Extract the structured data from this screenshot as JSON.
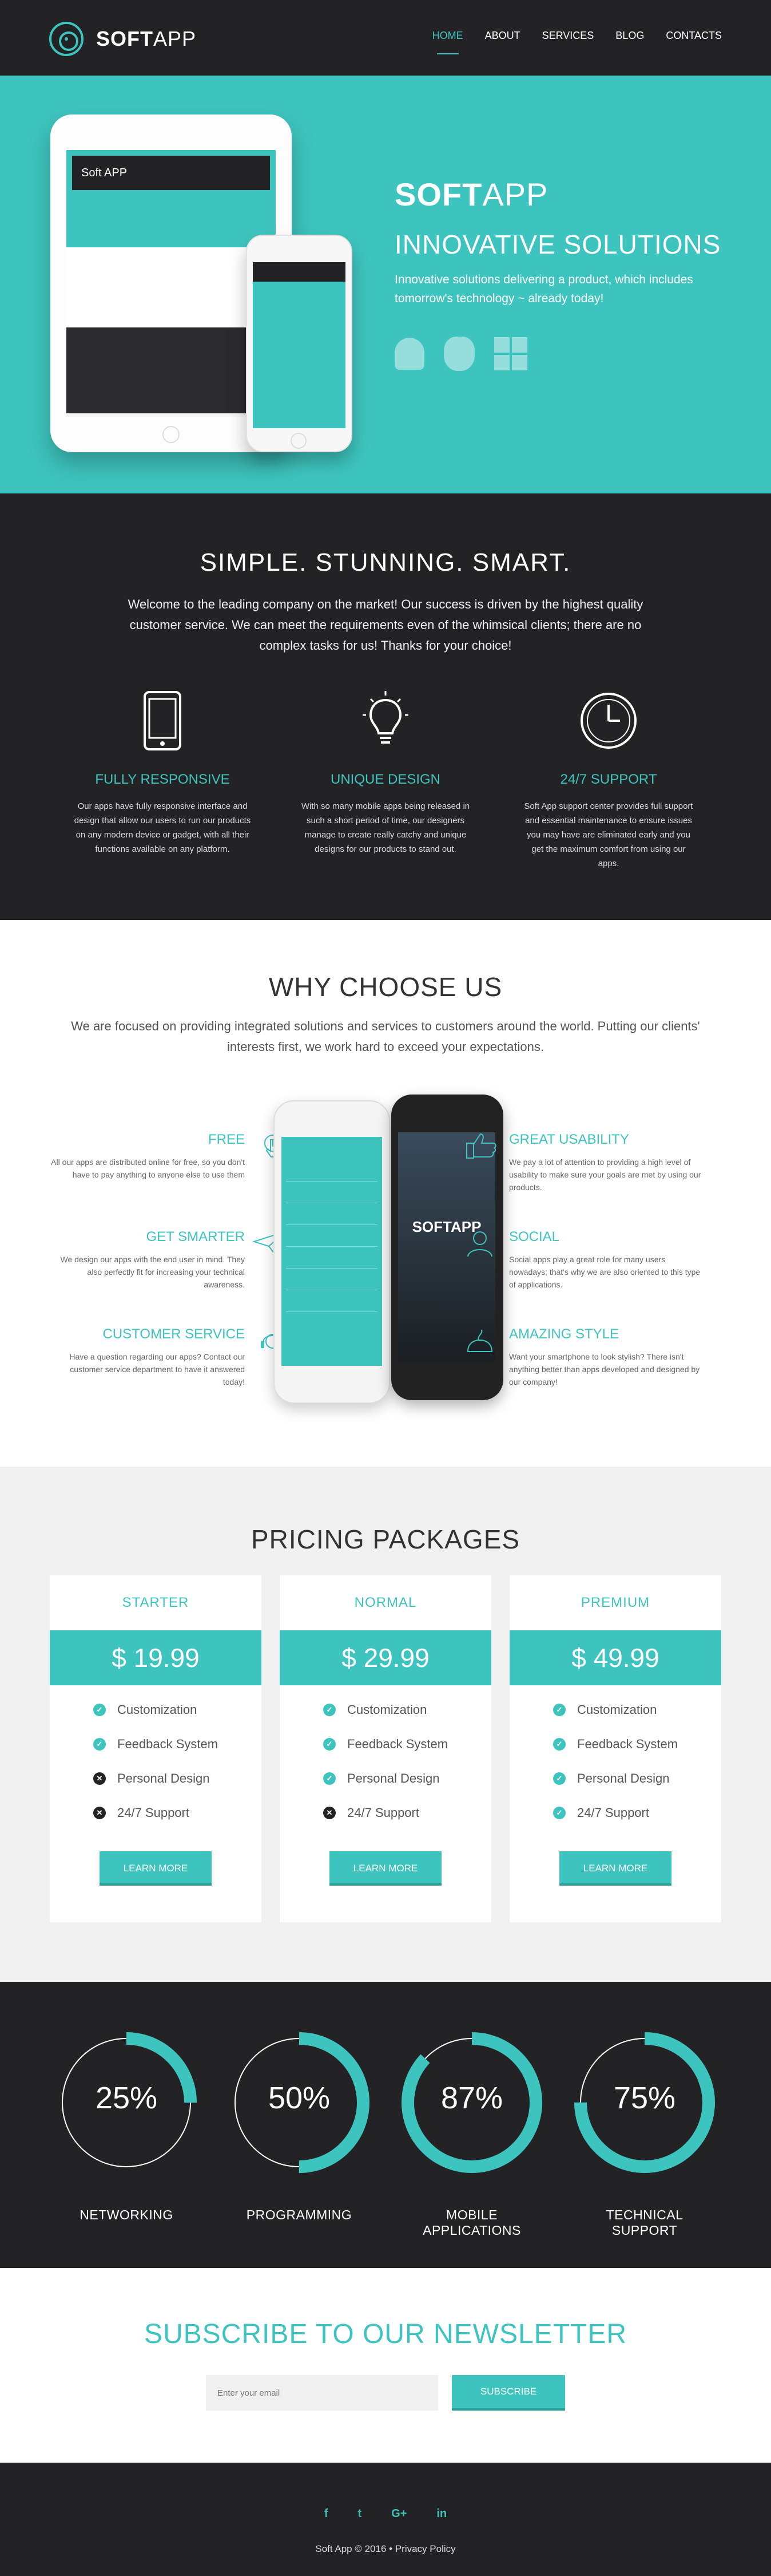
{
  "header": {
    "brand_bold": "SOFT",
    "brand_light": "APP",
    "nav": [
      "HOME",
      "ABOUT",
      "SERVICES",
      "BLOG",
      "CONTACTS"
    ],
    "active_nav": "HOME"
  },
  "hero": {
    "brand_bold": "SOFT",
    "brand_light": "APP",
    "tagline": "INNOVATIVE SOLUTIONS",
    "description": "Innovative solutions delivering a product, which includes tomorrow's technology ~ already today!",
    "device_brand": "Soft APP",
    "platforms": [
      "android-icon",
      "apple-icon",
      "windows-icon"
    ]
  },
  "simple": {
    "title": "SIMPLE. STUNNING. SMART.",
    "intro": "Welcome to the leading company on the market! Our success is driven by the highest quality customer service. We can meet the requirements even of the whimsical clients; there are no complex tasks for us! Thanks for your choice!",
    "features": [
      {
        "title": "FULLY RESPONSIVE",
        "icon": "tablet-icon",
        "text": "Our apps have fully responsive interface and design that allow our users to run our products on any modern device or gadget, with all their functions available on any platform."
      },
      {
        "title": "UNIQUE DESIGN",
        "icon": "lightbulb-icon",
        "text": "With so many mobile apps being released in such a short period of time, our designers manage to create really catchy and unique designs for our products to stand out."
      },
      {
        "title": "24/7 SUPPORT",
        "icon": "clock-icon",
        "text": "Soft App support center provides full support and essential maintenance to ensure issues you may have are eliminated early and you get the maximum comfort from using our apps."
      }
    ]
  },
  "why": {
    "title": "WHY CHOOSE US",
    "intro": "We are focused on providing integrated solutions and services to customers around the world. Putting our clients' interests first, we work hard to exceed your expectations.",
    "left": [
      {
        "title": "FREE",
        "icon": "touch-icon",
        "text": "All our apps are distributed online for free, so you don't have to pay anything to anyone else to use them"
      },
      {
        "title": "GET SMARTER",
        "icon": "paper-plane-icon",
        "text": "We design our apps with the end user in mind. They also perfectly fit for increasing your technical awareness."
      },
      {
        "title": "CUSTOMER SERVICE",
        "icon": "headset-icon",
        "text": "Have a question regarding our apps? Contact our customer service department to have it answered today!"
      }
    ],
    "right": [
      {
        "title": "GREAT USABILITY",
        "icon": "thumbs-up-icon",
        "text": "We pay a lot of attention to providing a high level of usability to make sure your goals are met by using our products."
      },
      {
        "title": "SOCIAL",
        "icon": "user-icon",
        "text": "Social apps play a great role for many users nowadays; that's why we are also oriented to this type of applications."
      },
      {
        "title": "AMAZING STYLE",
        "icon": "cake-icon",
        "text": "Want your smartphone to look stylish? There isn't anything better than apps developed and designed by our company!"
      }
    ],
    "phone_brand": "SOFTAPP"
  },
  "pricing": {
    "title": "PRICING PACKAGES",
    "plans": [
      {
        "name": "STARTER",
        "price": "$ 19.99",
        "button": "LEARN MORE",
        "features": [
          {
            "label": "Customization",
            "included": true
          },
          {
            "label": "Feedback System",
            "included": true
          },
          {
            "label": "Personal Design",
            "included": false
          },
          {
            "label": "24/7 Support",
            "included": false
          }
        ]
      },
      {
        "name": "NORMAL",
        "price": "$ 29.99",
        "button": "LEARN MORE",
        "features": [
          {
            "label": "Customization",
            "included": true
          },
          {
            "label": "Feedback System",
            "included": true
          },
          {
            "label": "Personal Design",
            "included": true
          },
          {
            "label": "24/7 Support",
            "included": false
          }
        ]
      },
      {
        "name": "PREMIUM",
        "price": "$ 49.99",
        "button": "LEARN MORE",
        "features": [
          {
            "label": "Customization",
            "included": true
          },
          {
            "label": "Feedback System",
            "included": true
          },
          {
            "label": "Personal Design",
            "included": true
          },
          {
            "label": "24/7 Support",
            "included": true
          }
        ]
      }
    ]
  },
  "stats": [
    {
      "value": 25,
      "label": "NETWORKING"
    },
    {
      "value": 50,
      "label": "PROGRAMMING"
    },
    {
      "value": 87,
      "label": "MOBILE APPLICATIONS"
    },
    {
      "value": 75,
      "label": "TECHNICAL SUPPORT"
    }
  ],
  "newsletter": {
    "title": "SUBSCRIBE TO OUR NEWSLETTER",
    "placeholder": "Enter your email",
    "button": "SUBSCRIBE"
  },
  "footer": {
    "socials": [
      {
        "glyph": "f",
        "icon": "facebook-icon"
      },
      {
        "glyph": "t",
        "icon": "twitter-icon"
      },
      {
        "glyph": "G+",
        "icon": "google-plus-icon"
      },
      {
        "glyph": "in",
        "icon": "linkedin-icon"
      }
    ],
    "copyright": "Soft App © 2016 • Privacy Policy"
  },
  "colors": {
    "accent": "#3ec4be",
    "dark": "#232326",
    "light_gray": "#f0f0f0"
  }
}
